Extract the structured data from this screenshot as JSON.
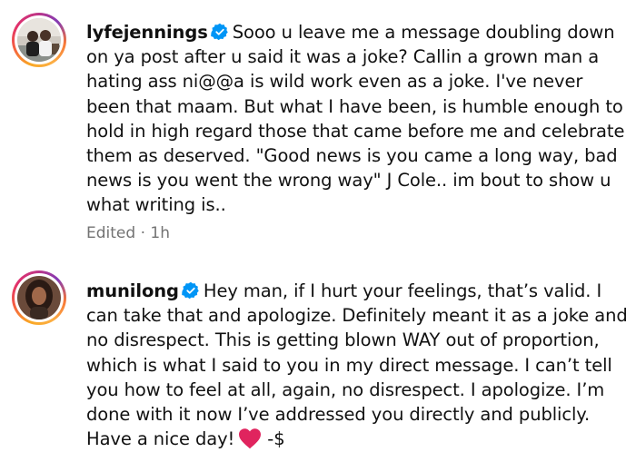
{
  "comments": [
    {
      "username": "lyfejennings",
      "verified": true,
      "text": "Sooo u leave me a message doubling down on ya post after u said it was a joke? Callin a grown man a hating ass ni@@a is wild work even as a joke. I've never been that maam. But what I have been, is humble enough to hold in high regard those that came before me and celebrate them as deserved. \"Good news is you came a long way, bad news is you went the wrong way\" J Cole.. im bout to show u what writing is..",
      "meta": "Edited · 1h",
      "avatar_icon": "profile-photo-two-people"
    },
    {
      "username": "munilong",
      "verified": true,
      "text": "Hey man, if I hurt your feelings, that’s valid. I can take that and apologize. Definitely meant it as a joke and no disrespect. This is getting blown WAY out of proportion, which is what I said to you in my direct message. I can’t tell you how to feel at all, again, no disrespect. I apologize. I’m done with it now I’ve addressed you directly and publicly. Have a nice day!",
      "emoji": "red-heart",
      "signoff": "-$",
      "avatar_icon": "profile-photo-woman"
    }
  ],
  "colors": {
    "verified_badge": "#0095f6",
    "meta_text": "#737373",
    "heart": "#e0245e"
  }
}
